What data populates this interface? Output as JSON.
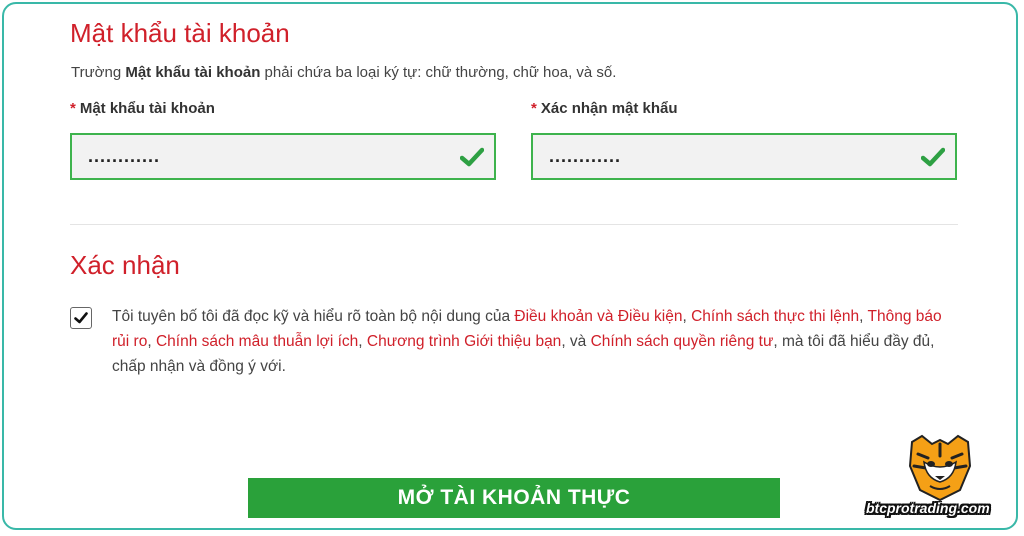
{
  "password_section": {
    "title": "Mật khẩu tài khoản",
    "help_prefix": "Trường ",
    "help_bold": "Mật khẩu tài khoản",
    "help_suffix": " phải chứa ba loại ký tự: chữ thường, chữ hoa, và số.",
    "required_mark": "*",
    "password_label": "Mật khẩu tài khoản",
    "password_value": "............",
    "confirm_label": "Xác nhận mật khẩu",
    "confirm_value": "............"
  },
  "confirm_section": {
    "title": "Xác nhận",
    "checkbox_checked": true,
    "text_1": "Tôi tuyên bố tôi đã đọc kỹ và hiểu rõ toàn bộ nội dung của ",
    "link_terms": "Điều khoản và Điều kiện",
    "sep_1": ", ",
    "link_execution": "Chính sách thực thi lệnh",
    "sep_2": ", ",
    "link_risk": "Thông báo rủi ro",
    "sep_3": ", ",
    "link_conflict": "Chính sách mâu thuẫn lợi ích",
    "sep_4": ", ",
    "link_referral": "Chương trình Giới thiệu bạn",
    "sep_5": ", và ",
    "link_privacy": "Chính sách quyền riêng tư",
    "text_2": ", mà tôi đã hiểu đầy đủ, chấp nhận và đồng ý với."
  },
  "submit_label": "MỞ TÀI KHOẢN THỰC",
  "watermark": {
    "logo_icon": "tiger-head-icon",
    "text": "btcprotrading.com"
  },
  "colors": {
    "accent_red": "#d0202a",
    "success_green": "#3eb34d",
    "button_green": "#2aa13a",
    "frame_teal": "#39b8a8"
  }
}
